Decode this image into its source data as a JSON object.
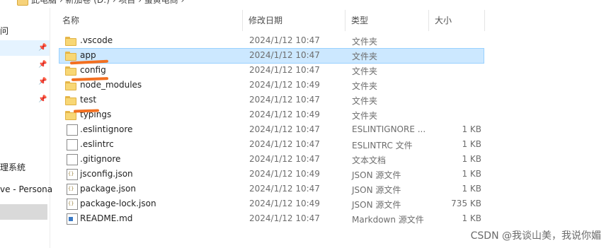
{
  "breadcrumb": {
    "text": "此电脑 › 新加卷 (D:) › 项目 › 蛋黄电商 ›"
  },
  "nav": {
    "items": [
      {
        "label": "问"
      },
      {
        "label": ""
      },
      {
        "label": ""
      },
      {
        "label": ""
      },
      {
        "label": ""
      },
      {
        "label": "理系统"
      },
      {
        "label": "ve - Persona"
      },
      {
        "label": ""
      }
    ]
  },
  "columns": {
    "name": "名称",
    "date": "修改日期",
    "type": "类型",
    "size": "大小"
  },
  "files": [
    {
      "name": ".vscode",
      "date": "2024/1/12 10:47",
      "type": "文件夹",
      "size": "",
      "icon": "folder"
    },
    {
      "name": "app",
      "date": "2024/1/12 10:47",
      "type": "文件夹",
      "size": "",
      "icon": "folder"
    },
    {
      "name": "config",
      "date": "2024/1/12 10:47",
      "type": "文件夹",
      "size": "",
      "icon": "folder"
    },
    {
      "name": "node_modules",
      "date": "2024/1/12 10:49",
      "type": "文件夹",
      "size": "",
      "icon": "folder"
    },
    {
      "name": "test",
      "date": "2024/1/12 10:47",
      "type": "文件夹",
      "size": "",
      "icon": "folder"
    },
    {
      "name": "typings",
      "date": "2024/1/12 10:49",
      "type": "文件夹",
      "size": "",
      "icon": "folder"
    },
    {
      "name": ".eslintignore",
      "date": "2024/1/12 10:47",
      "type": "ESLINTIGNORE ...",
      "size": "1 KB",
      "icon": "file"
    },
    {
      "name": ".eslintrc",
      "date": "2024/1/12 10:47",
      "type": "ESLINTRC 文件",
      "size": "1 KB",
      "icon": "file"
    },
    {
      "name": ".gitignore",
      "date": "2024/1/12 10:47",
      "type": "文本文档",
      "size": "1 KB",
      "icon": "file"
    },
    {
      "name": "jsconfig.json",
      "date": "2024/1/12 10:49",
      "type": "JSON 源文件",
      "size": "1 KB",
      "icon": "json"
    },
    {
      "name": "package.json",
      "date": "2024/1/12 10:47",
      "type": "JSON 源文件",
      "size": "1 KB",
      "icon": "json"
    },
    {
      "name": "package-lock.json",
      "date": "2024/1/12 10:49",
      "type": "JSON 源文件",
      "size": "735 KB",
      "icon": "json"
    },
    {
      "name": "README.md",
      "date": "2024/1/12 10:47",
      "type": "Markdown 源文件",
      "size": "1 KB",
      "icon": "md"
    }
  ],
  "colors": {
    "selection": "#cce8ff",
    "annotation": "#f37021",
    "folder": "#f8d775"
  },
  "watermark": "CSDN @我谈山美，我说你媚"
}
